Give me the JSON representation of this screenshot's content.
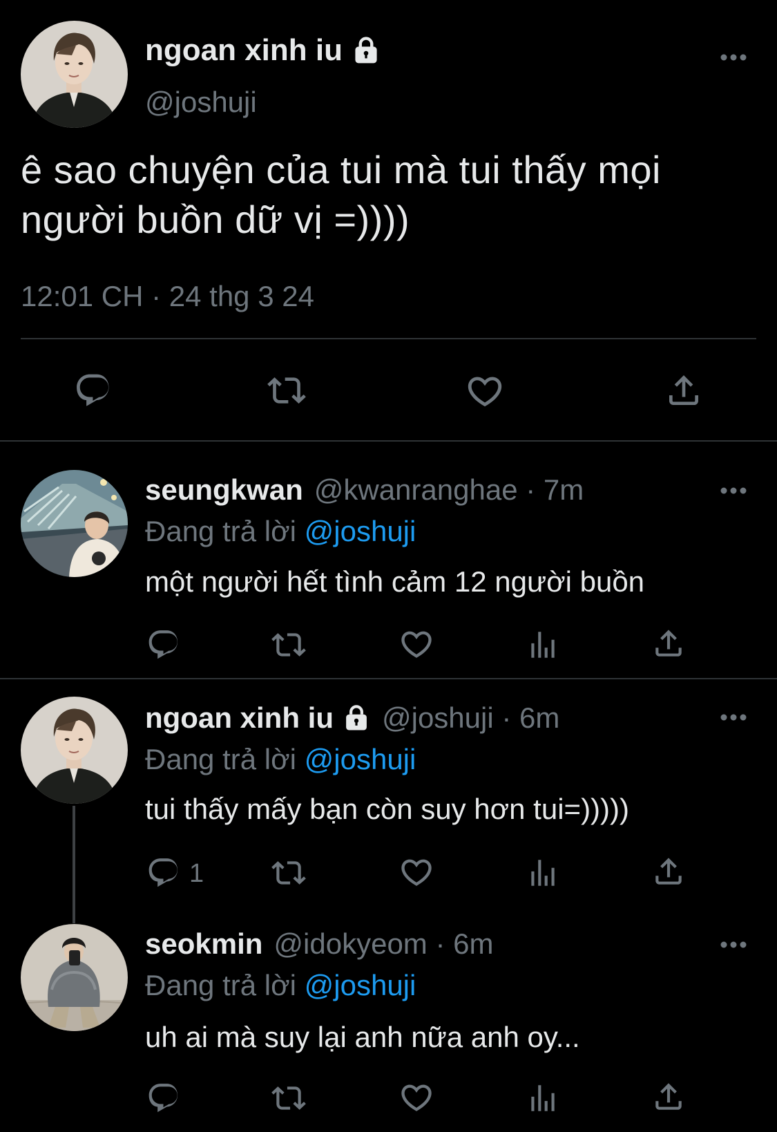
{
  "main_tweet": {
    "display_name": "ngoan xinh iu",
    "handle": "@joshuji",
    "text": "ê sao chuyện của tui mà tui thấy mọi người buồn dữ vị =))))",
    "timestamp": "12:01 CH · 24 thg 3 24",
    "icons": [
      "reply-icon",
      "retweet-icon",
      "like-icon",
      "share-icon"
    ]
  },
  "replies": [
    {
      "display_name": "seungkwan",
      "meta": "@kwanranghae · 7m",
      "replying_prefix": "Đang trả lời ",
      "replying_to": "@joshuji",
      "text": "một người hết tình cảm 12 người buồn",
      "reply_count": ""
    },
    {
      "display_name": "ngoan xinh iu",
      "meta": "@joshuji · 6m",
      "replying_prefix": "Đang trả lời ",
      "replying_to": "@joshuji",
      "text": "tui thấy mấy bạn còn suy hơn tui=)))))",
      "reply_count": "1"
    },
    {
      "display_name": "seokmin",
      "meta": "@idokyeom · 6m",
      "replying_prefix": "Đang trả lời ",
      "replying_to": "@joshuji",
      "text": "uh ai mà suy lại anh nữa anh oy...",
      "reply_count": ""
    }
  ],
  "colors": {
    "background": "#000000",
    "text": "#e7e9ea",
    "secondary": "#6e767d",
    "mention": "#1d9bf0",
    "divider": "#2f3336"
  }
}
